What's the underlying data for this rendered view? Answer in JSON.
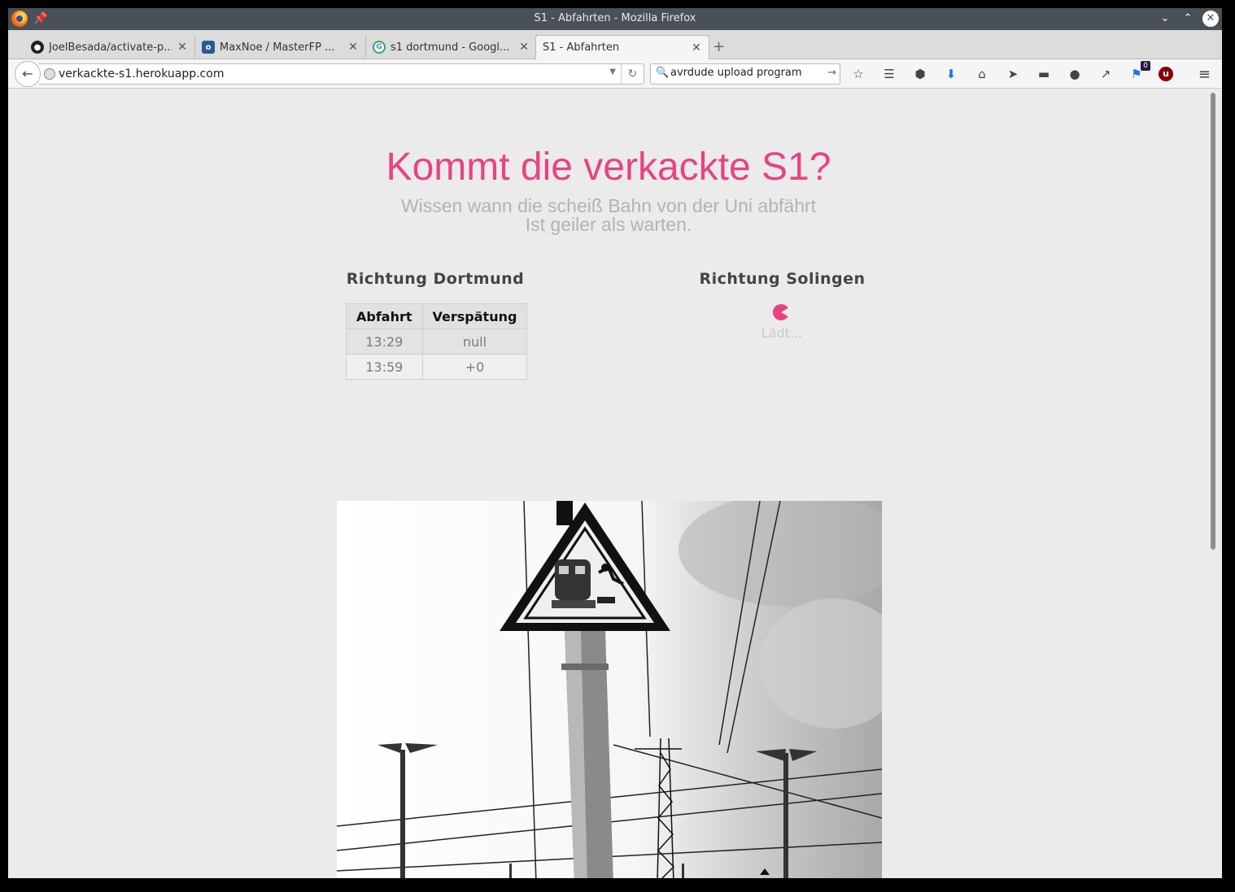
{
  "window": {
    "title": "S1 - Abfahrten - Mozilla Firefox"
  },
  "tabs": [
    {
      "label": "JoelBesada/activate-p...",
      "icon": "github-icon"
    },
    {
      "label": "MaxNoe / MasterFP ...",
      "icon": "gitlab-icon"
    },
    {
      "label": "s1 dortmund - Googl...",
      "icon": "google-icon"
    },
    {
      "label": "S1 - Abfahrten",
      "icon": "none",
      "active": true
    }
  ],
  "navbar": {
    "url": "verkackte-s1.herokuapp.com",
    "search_value": "avrdude upload program",
    "extension_badge": "0"
  },
  "page": {
    "headline": "Kommt die verkackte S1?",
    "subline_1": "Wissen wann die scheiß Bahn von der Uni abfährt",
    "subline_2": "Ist geiler als warten.",
    "col_dortmund": "Richtung Dortmund",
    "col_solingen": "Richtung Solingen",
    "table_headers": [
      "Abfahrt",
      "Verspätung"
    ],
    "departures": [
      {
        "time": "13:29",
        "delay": "null"
      },
      {
        "time": "13:59",
        "delay": "+0"
      }
    ],
    "loading_text": "Lädt..."
  },
  "colors": {
    "accent": "#e84382",
    "subtitle": "#b3b3b3"
  }
}
